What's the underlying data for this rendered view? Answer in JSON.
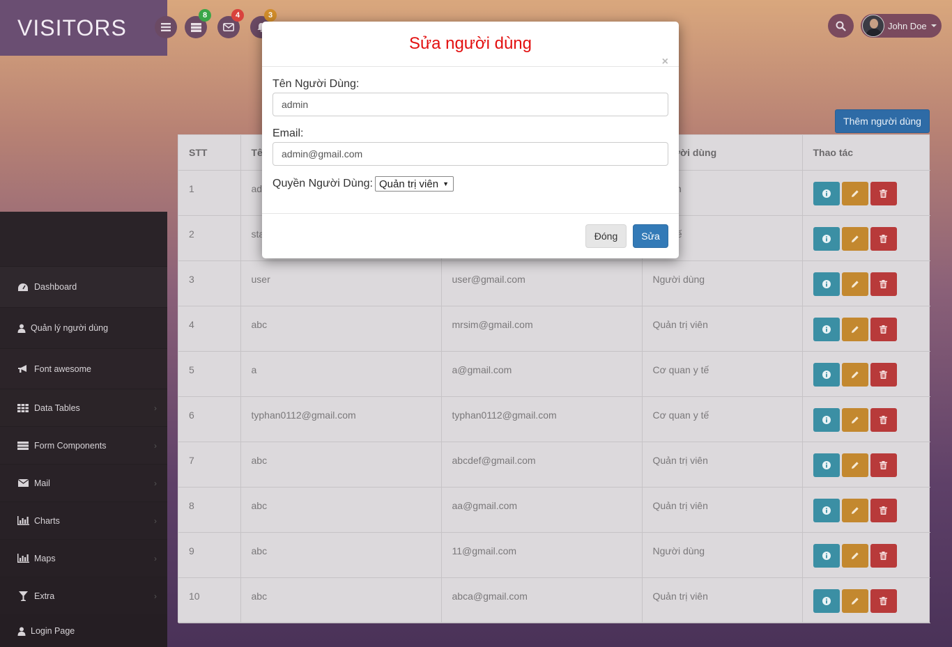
{
  "brand": {
    "title": "VISITORS"
  },
  "topbar": {
    "badges": {
      "tasks": "8",
      "mail": "4",
      "notifications": "3"
    },
    "user_name": "John Doe"
  },
  "sidebar": {
    "items": [
      {
        "label": "Dashboard",
        "icon": "dashboard-icon"
      },
      {
        "label": "Quản lý người dùng",
        "icon": "user-icon"
      },
      {
        "label": "Font awesome",
        "icon": "bullhorn-icon"
      },
      {
        "label": "Data Tables",
        "icon": "table-icon"
      },
      {
        "label": "Form Components",
        "icon": "form-icon"
      },
      {
        "label": "Mail",
        "icon": "envelope-icon"
      },
      {
        "label": "Charts",
        "icon": "bar-chart-icon"
      },
      {
        "label": "Maps",
        "icon": "bar-chart-icon"
      },
      {
        "label": "Extra",
        "icon": "glass-icon"
      },
      {
        "label": "Login Page",
        "icon": "user-icon"
      }
    ]
  },
  "add_button": "Thêm người dùng",
  "table": {
    "headers": [
      "STT",
      "Tê",
      "",
      "n người dùng",
      "Thao tác"
    ],
    "rows": [
      [
        "1",
        "ad",
        "",
        "trị viên"
      ],
      [
        "2",
        "sta",
        "",
        "an y tế"
      ],
      [
        "3",
        "user",
        "user@gmail.com",
        "Người dùng"
      ],
      [
        "4",
        "abc",
        "mrsim@gmail.com",
        "Quản trị viên"
      ],
      [
        "5",
        "a",
        "a@gmail.com",
        "Cơ quan y tế"
      ],
      [
        "6",
        "typhan0112@gmail.com",
        "typhan0112@gmail.com",
        "Cơ quan y tế"
      ],
      [
        "7",
        "abc",
        "abcdef@gmail.com",
        "Quản trị viên"
      ],
      [
        "8",
        "abc",
        "aa@gmail.com",
        "Quản trị viên"
      ],
      [
        "9",
        "abc",
        "11@gmail.com",
        "Người dùng"
      ],
      [
        "10",
        "abc",
        "abca@gmail.com",
        "Quản trị viên"
      ]
    ]
  },
  "modal": {
    "title": "Sửa người dùng",
    "close_symbol": "×",
    "username_label": "Tên Người Dùng:",
    "username_value": "admin",
    "email_label": "Email:",
    "email_value": "admin@gmail.com",
    "role_label": "Quyền Người Dùng:",
    "role_selected": "Quản trị viên",
    "close_button": "Đóng",
    "save_button": "Sửa"
  },
  "colors": {
    "title_red": "#e31010",
    "primary": "#337ab7",
    "info": "#3b8fa4",
    "warning": "#c3882f",
    "danger": "#b83a3a",
    "badge_green": "#3aa648",
    "badge_red": "#d9423d",
    "badge_orange": "#d18d2a"
  }
}
